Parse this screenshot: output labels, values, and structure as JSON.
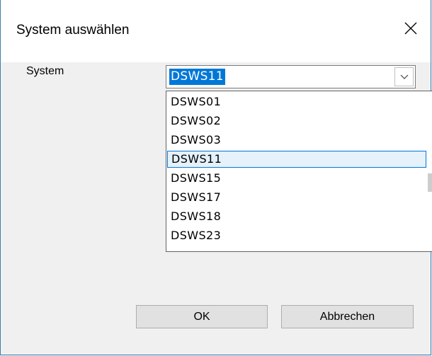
{
  "dialog": {
    "title": "System auswählen",
    "close_icon": "close-icon"
  },
  "form": {
    "system_label": "System",
    "selected_value": "DSWS11",
    "dropdown_icon": "chevron-down-icon"
  },
  "options": [
    "DSWS01",
    "DSWS02",
    "DSWS03",
    "DSWS11",
    "DSWS15",
    "DSWS17",
    "DSWS18",
    "DSWS23"
  ],
  "selected_index": 3,
  "buttons": {
    "ok_label": "OK",
    "cancel_label": "Abbrechen"
  },
  "colors": {
    "accent": "#0078d7",
    "highlight_bg": "#e5f1fb",
    "window_border": "#3c7fb1"
  }
}
